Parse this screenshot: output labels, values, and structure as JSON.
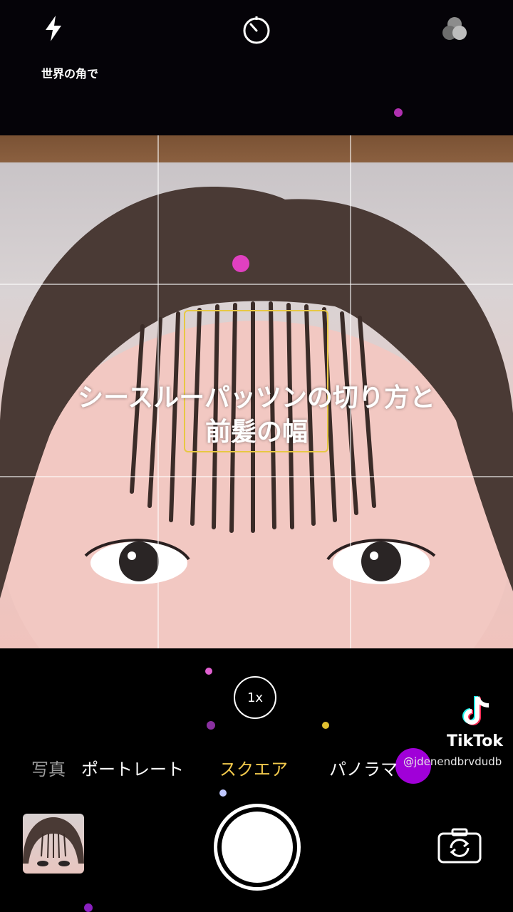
{
  "status": {
    "song_title": "世界の角で"
  },
  "top_controls": {
    "flash_icon": "lightning-bolt",
    "timer_icon": "timer",
    "filters_icon": "three-circles"
  },
  "viewfinder": {
    "caption_line1": "シースルーパッツンの切り方と",
    "caption_line2": "前髪の幅",
    "focus_box_color": "#e7c844"
  },
  "zoom": {
    "label": "1x"
  },
  "modes": {
    "items": [
      "写真",
      "ポートレート",
      "スクエア",
      "パノラマ"
    ],
    "active": "スクエア",
    "active_color": "#f2c94c"
  },
  "watermark": {
    "brand": "TikTok",
    "username": "@jdenendbrvdudb"
  },
  "bottom_controls": {
    "thumbnail": "last-photo-preview",
    "shutter": "shutter-button",
    "switch_camera_icon": "camera-rotate"
  }
}
